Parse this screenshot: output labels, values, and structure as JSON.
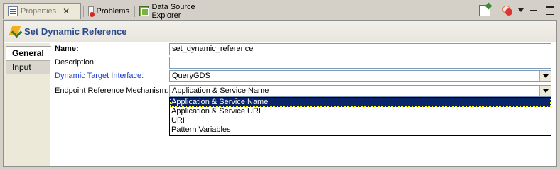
{
  "tabs": [
    {
      "label": "Properties",
      "icon": "properties-icon",
      "active": true
    },
    {
      "label": "Problems",
      "icon": "problems-icon"
    },
    {
      "label": "Data Source Explorer",
      "icon": "data-source-explorer-icon"
    }
  ],
  "panel": {
    "title": "Set Dynamic Reference",
    "title_icon": "set-dynamic-reference-icon",
    "side_tabs": [
      "General",
      "Input"
    ]
  },
  "form": {
    "name_label": "Name:",
    "name_value": "set_dynamic_reference",
    "description_label": "Description:",
    "description_value": "",
    "dti_label": "Dynamic Target Interface:",
    "dti_value": "QueryGDS",
    "erm_label": "Endpoint Reference Mechanism:",
    "erm_value": "Application & Service Name",
    "erm_options": [
      "Application & Service Name",
      "Application & Service URI",
      "URI",
      "Pattern Variables"
    ]
  },
  "colors": {
    "title_text": "#2a4a8a",
    "link": "#1a3ccd",
    "selection": "#0a246a"
  }
}
